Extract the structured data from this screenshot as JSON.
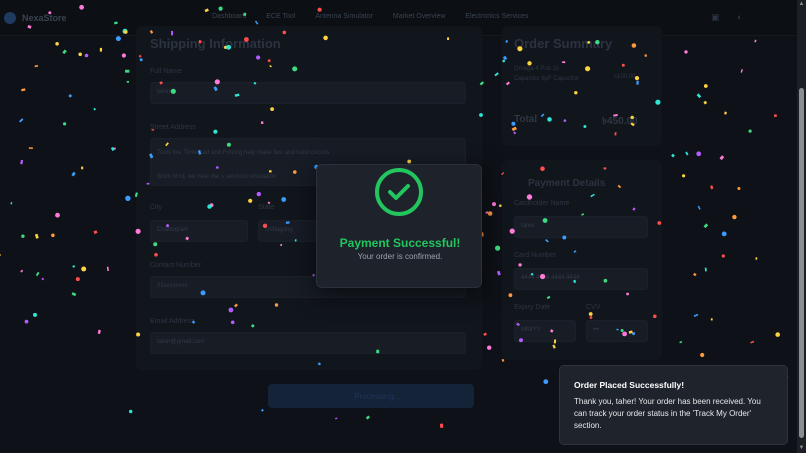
{
  "nav": {
    "brand": "NexaStore",
    "links": [
      "Dashboard",
      "ECE Tool",
      "Antenna Simulator",
      "Market Overview",
      "Electronics Services"
    ]
  },
  "shipping": {
    "title": "Shipping Information",
    "full_name_label": "Full Name",
    "full_name_value": "taher",
    "street_label": "Street Address",
    "street_line1": "Tools like Tinkercad and Fritzing help make fast and build circuits",
    "street_line2": "Work of rd, we near the s services simulation",
    "city_label": "City",
    "city_value": "Chattogram",
    "state_label": "State",
    "state_value": "chittagong",
    "contact_label": "Contact Number",
    "contact_value": "01xxxxxxxx",
    "email_label": "Email Address",
    "email_value": "taher@gmail.com"
  },
  "summary": {
    "title": "Order Summary",
    "item_line1": "Omega 4 Pub 2x",
    "item_line2": "Capacitor 8pF Capacitor",
    "item_price": "৳100.00",
    "total_label": "Total",
    "total_value": "৳450.00"
  },
  "payment": {
    "title": "Payment Details",
    "cardholder_label": "Cardholder Name",
    "cardholder_value": "taher",
    "card_number_label": "Card Number",
    "card_number_value": "4444 4444 4444 4444",
    "expiry_label": "Expiry Date",
    "expiry_value": "MM/YY",
    "cvv_label": "CVV",
    "cvv_value": "•••"
  },
  "pay_button": "Processing...",
  "modal": {
    "title": "Payment Successful!",
    "subtitle": "Your order is confirmed."
  },
  "toast": {
    "title": "Order Placed Successfully!",
    "body": "Thank you, taher! Your order has been received. You can track your order status in the 'Track My Order' section."
  },
  "colors": {
    "success": "#22c55e",
    "background": "#0e1117",
    "toast_bg": "#1f242c"
  },
  "confetti_colors": [
    "#ff4d4d",
    "#ffd23f",
    "#3ddc84",
    "#3b9cff",
    "#b45cff",
    "#ff7ad9",
    "#ff9a3d",
    "#2ee6d6"
  ]
}
